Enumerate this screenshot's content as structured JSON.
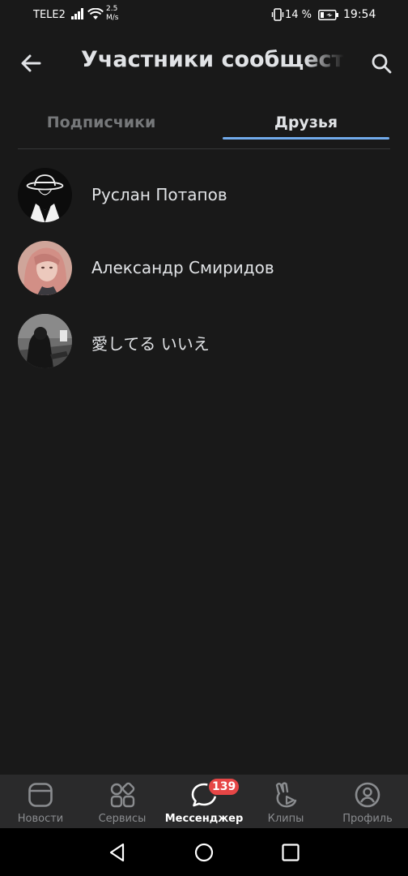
{
  "status_bar": {
    "carrier": "TELE2",
    "speed_value": "2.5",
    "speed_unit": "M/s",
    "battery": "14 %",
    "time": "19:54"
  },
  "header": {
    "title": "Участники сообщест"
  },
  "tabs": [
    {
      "label": "Подписчики",
      "active": false
    },
    {
      "label": "Друзья",
      "active": true
    }
  ],
  "members": [
    {
      "name": "Руслан Потапов"
    },
    {
      "name": "Александр Смиридов"
    },
    {
      "name": "愛してる いいえ"
    }
  ],
  "tabbar": {
    "items": [
      {
        "label": "Новости",
        "icon": "news-icon"
      },
      {
        "label": "Сервисы",
        "icon": "services-icon"
      },
      {
        "label": "Мессенджер",
        "icon": "messenger-icon",
        "active": true
      },
      {
        "label": "Клипы",
        "icon": "clips-icon"
      },
      {
        "label": "Профиль",
        "icon": "profile-icon"
      }
    ],
    "messenger_badge": "139"
  },
  "colors": {
    "background": "#191919",
    "accent": "#71aaeb",
    "badge": "#e64646",
    "tabbar": "#2a2a2b"
  }
}
